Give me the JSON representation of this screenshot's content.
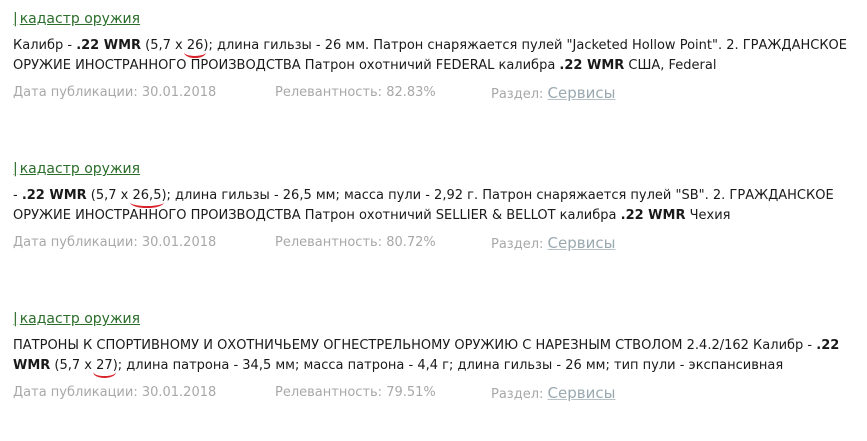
{
  "results": [
    {
      "source": "кадастр оружия",
      "snippet": {
        "t1": "Калибр - ",
        "b1": ".22 WMR",
        "t2": " (5,7 х ",
        "hl": "26",
        "t3": "); длина гильзы - 26 мм. Патрон снаряжается пулей \"Jacketed Hollow Point\". 2. ГРАЖДАНСКОЕ ОРУЖИЕ ИНОСТРАННОГО ПРОИЗВОДСТВА Патрон охотничий FEDERAL калибра ",
        "b2": ".22 WMR",
        "t4": " США, Federal"
      },
      "date_label": "Дата публикации: 30.01.2018",
      "relevance_label": "Релевантность: 82.83%",
      "section_label": "Раздел: ",
      "section_link": "Сервисы"
    },
    {
      "source": "кадастр оружия",
      "snippet": {
        "t1": "- ",
        "b1": ".22 WMR",
        "t2": " (5,7 х ",
        "hl": "26,5",
        "t3": "); длина гильзы - 26,5 мм; масса пули - 2,92 г. Патрон снаряжается пулей \"SB\". 2. ГРАЖДАНСКОЕ ОРУЖИЕ ИНОСТРАННОГО ПРОИЗВОДСТВА Патрон охотничий SELLIER & BELLOT калибра ",
        "b2": ".22 WMR",
        "t4": " Чехия"
      },
      "date_label": "Дата публикации: 30.01.2018",
      "relevance_label": "Релевантность: 80.72%",
      "section_label": "Раздел: ",
      "section_link": "Сервисы"
    },
    {
      "source": "кадастр оружия",
      "snippet": {
        "t1": "ПАТРОНЫ К СПОРТИВНОМУ И ОХОТНИЧЬЕМУ ОГНЕСТРЕЛЬНОМУ ОРУЖИЮ С НАРЕЗНЫМ СТВОЛОМ 2.4.2/162 Калибр - ",
        "b1": ".22 WMR",
        "t2": " (5,7 х ",
        "hl": "27",
        "t3": "); длина патрона - 34,5 мм; масса патрона - 4,4 г; длина гильзы - 26 мм; тип пули - экспансивная",
        "b2": "",
        "t4": ""
      },
      "date_label": "Дата публикации: 30.01.2018",
      "relevance_label": "Релевантность: 79.51%",
      "section_label": "Раздел: ",
      "section_link": "Сервисы"
    }
  ],
  "colors": {
    "link": "#2c6e2c",
    "meta": "#a8a8a8",
    "section_link": "#9aa9b0",
    "highlight_underline": "#d8232a"
  }
}
